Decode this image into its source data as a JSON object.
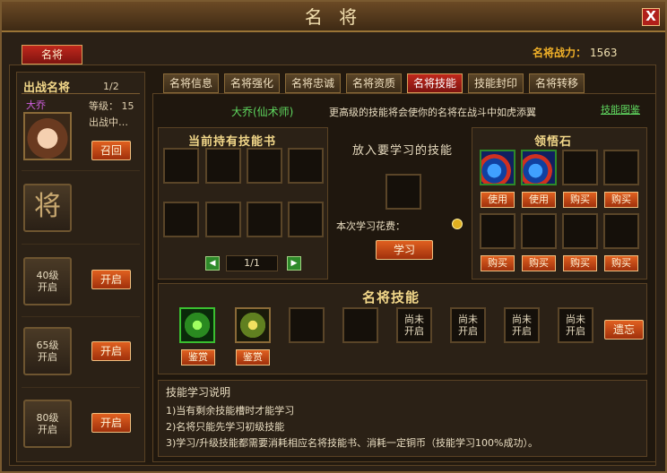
{
  "window": {
    "title": "名 将",
    "close": "X"
  },
  "top": {
    "tab": "名将",
    "power_label": "名将战力：",
    "power_value": "1563"
  },
  "left": {
    "header": "出战名将",
    "count": "1/2",
    "hero": {
      "name": "大乔",
      "level_label": "等级：",
      "level": "15",
      "status": "出战中…",
      "recall": "召回"
    },
    "slot_general": "将",
    "locked": [
      {
        "label1": "40级",
        "label2": "开启",
        "button": "开启"
      },
      {
        "label1": "65级",
        "label2": "开启",
        "button": "开启"
      },
      {
        "label1": "80级",
        "label2": "开启",
        "button": "开启"
      }
    ]
  },
  "tabs": [
    "名将信息",
    "名将强化",
    "名将忠诚",
    "名将资质",
    "名将技能",
    "技能封印",
    "名将转移"
  ],
  "active_tab": "名将技能",
  "info": {
    "hero": "大乔(仙术师)",
    "hint": "更高级的技能将会使你的名将在战斗中如虎添翼",
    "link": "技能图鉴"
  },
  "books": {
    "title": "当前持有技能书",
    "page": "1/1",
    "prev": "◀",
    "next": "▶"
  },
  "learn": {
    "title": "放入要学习的技能",
    "cost_label": "本次学习花费：",
    "button": "学习"
  },
  "stones": {
    "title": "领悟石",
    "row1": [
      "使用",
      "使用",
      "购买",
      "购买"
    ],
    "row2": [
      "购买",
      "购买",
      "购买",
      "购买"
    ]
  },
  "skills": {
    "title": "名将技能",
    "buttons": [
      "鉴赏",
      "鉴赏"
    ],
    "locked_label1": "尚未",
    "locked_label2": "开启",
    "forget": "遗忘"
  },
  "desc": {
    "title": "技能学习说明",
    "lines": [
      "1)当有剩余技能槽时才能学习",
      "2)名将只能先学习初级技能",
      "3)学习/升级技能都需要消耗相应名将技能书、消耗一定铜币（技能学习100%成功）。"
    ]
  },
  "colors": {
    "accent": "#f0b028",
    "red": "#c0281c",
    "orange": "#e06020",
    "green": "#2e8a2a"
  }
}
